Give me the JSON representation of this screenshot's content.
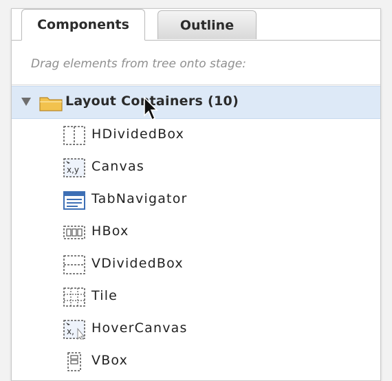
{
  "tabs": {
    "components": "Components",
    "outline": "Outline"
  },
  "hint": "Drag elements from tree onto stage:",
  "tree": {
    "group_label": "Layout Containers (10)",
    "items": [
      {
        "label": "HDividedBox",
        "icon": "hdividedbox-icon"
      },
      {
        "label": "Canvas",
        "icon": "canvas-icon"
      },
      {
        "label": "TabNavigator",
        "icon": "tabnavigator-icon"
      },
      {
        "label": "HBox",
        "icon": "hbox-icon"
      },
      {
        "label": "VDividedBox",
        "icon": "vdividedbox-icon"
      },
      {
        "label": "Tile",
        "icon": "tile-icon"
      },
      {
        "label": "HoverCanvas",
        "icon": "hovercanvas-icon"
      },
      {
        "label": "VBox",
        "icon": "vbox-icon"
      }
    ]
  },
  "colors": {
    "selection": "#dde9f7",
    "folder": "#f2c24e",
    "icon_blue": "#3d6fb5"
  }
}
